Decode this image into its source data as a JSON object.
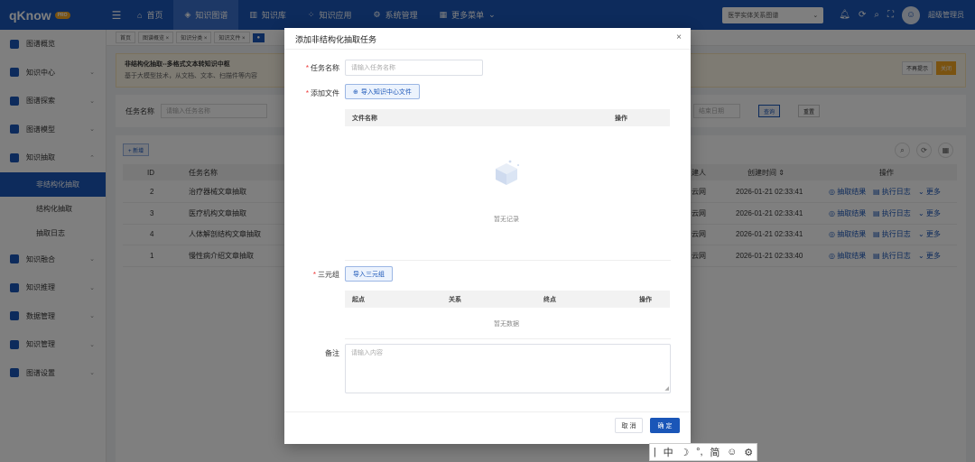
{
  "brand": {
    "logo_text": "qKnow",
    "logo_badge": "PRO"
  },
  "topnav": {
    "items": [
      {
        "label": "首页",
        "icon": "home-icon",
        "glyph": "⌂"
      },
      {
        "label": "知识图谱",
        "icon": "graph-icon",
        "glyph": "◈"
      },
      {
        "label": "知识库",
        "icon": "library-icon",
        "glyph": "▥"
      },
      {
        "label": "知识应用",
        "icon": "app-icon",
        "glyph": "⁘"
      },
      {
        "label": "系统管理",
        "icon": "gear-icon",
        "glyph": "⚙"
      },
      {
        "label": "更多菜单",
        "icon": "grid-icon",
        "glyph": "▦"
      }
    ],
    "more_chevron": "⌄",
    "graph_select": "医学实体关系图谱",
    "username": "超级管理员"
  },
  "sidebar": {
    "items": [
      {
        "label": "图谱概览"
      },
      {
        "label": "知识中心"
      },
      {
        "label": "图谱探索"
      },
      {
        "label": "图谱模型"
      },
      {
        "label": "知识抽取"
      }
    ],
    "sub_items": [
      {
        "label": "非结构化抽取"
      },
      {
        "label": "结构化抽取"
      },
      {
        "label": "抽取日志"
      }
    ],
    "items_after": [
      {
        "label": "知识融合"
      },
      {
        "label": "知识推理"
      },
      {
        "label": "数据管理"
      },
      {
        "label": "知识管理"
      },
      {
        "label": "图谱设置"
      }
    ]
  },
  "tabs": [
    "首页",
    "图谱概览 ×",
    "知识分类 ×",
    "知识文件 ×",
    "● "
  ],
  "notice": {
    "title": "非结构化抽取--多格式文本转知识中枢",
    "desc": "基于大模型技术，从文档、文本、扫描件等内容",
    "no_remind": "不再提示",
    "close": "关闭"
  },
  "search": {
    "task_label": "任务名称",
    "task_placeholder": "请输入任务名称",
    "end_date_placeholder": "结束日期",
    "search_btn": "查询",
    "reset_btn": "重置"
  },
  "table": {
    "add_btn": "+ 新增",
    "headers": {
      "id": "ID",
      "name": "任务名称",
      "creator": "建人",
      "time": "创建时间 ⇕",
      "ops": "操作"
    },
    "rows": [
      {
        "id": "2",
        "name": "治疗器械文章抽取",
        "creator": "云网",
        "time": "2026-01-21 02:33:41"
      },
      {
        "id": "3",
        "name": "医疗机构文章抽取",
        "creator": "云网",
        "time": "2026-01-21 02:33:41"
      },
      {
        "id": "4",
        "name": "人体解剖结构文章抽取",
        "creator": "云网",
        "time": "2026-01-21 02:33:41"
      },
      {
        "id": "1",
        "name": "慢性病介绍文章抽取",
        "creator": "云网",
        "time": "2026-01-21 02:33:40"
      }
    ],
    "op_labels": {
      "result": "◎ 抽取结果",
      "log": "▤ 执行日志",
      "more": "⌄ 更多"
    }
  },
  "modal": {
    "title": "添加非结构化抽取任务",
    "close": "×",
    "task_name_label": "任务名称",
    "task_name_placeholder": "请输入任务名称",
    "add_file_label": "添加文件",
    "import_file_btn": "导入知识中心文件",
    "file_table_headers": {
      "name": "文件名称",
      "op": "操作"
    },
    "file_empty": "暂无记录",
    "triple_label": "三元组",
    "import_triple_btn": "导入三元组",
    "triple_headers": {
      "start": "起点",
      "relation": "关系",
      "end": "终点",
      "op": "操作"
    },
    "triple_empty": "暂无数据",
    "remark_label": "备注",
    "remark_placeholder": "请输入内容",
    "cancel": "取 消",
    "ok": "确 定"
  },
  "ime": {
    "items": [
      "|",
      "中",
      "☽",
      "°,",
      "简",
      "☺",
      "⚙"
    ]
  },
  "colors": {
    "primary": "#1a56b8",
    "warning": "#f5a623",
    "danger": "#e33333"
  }
}
